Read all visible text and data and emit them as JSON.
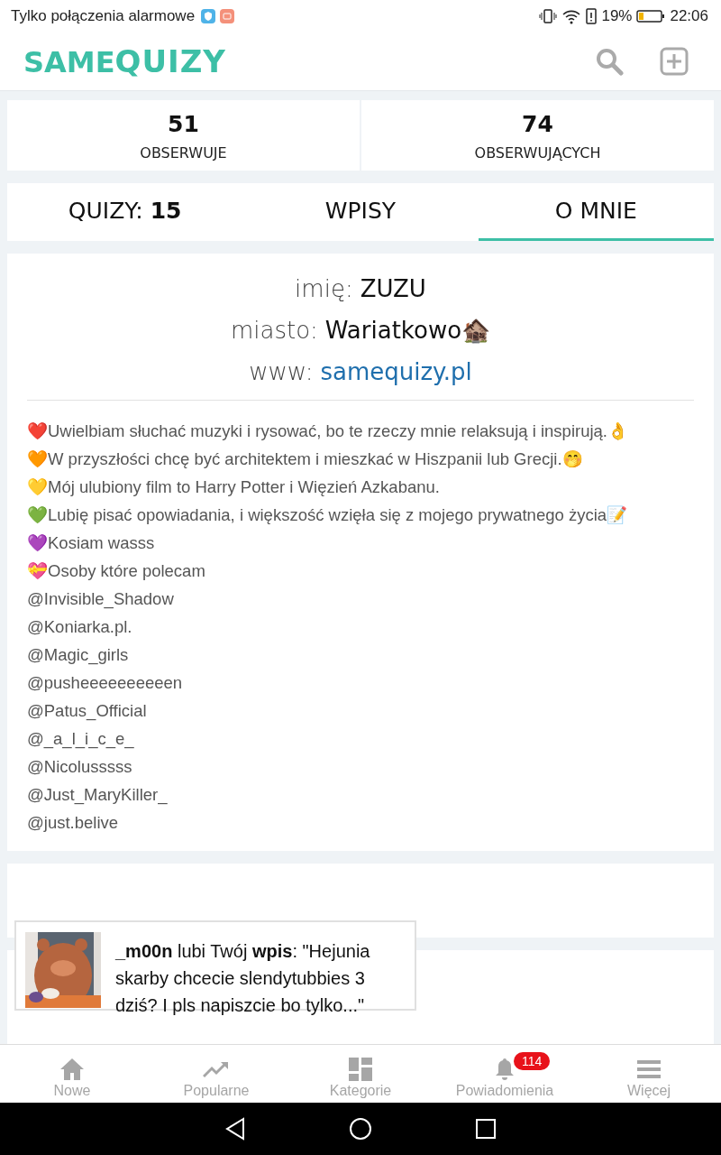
{
  "status_bar": {
    "carrier": "Tylko połączenia alarmowe",
    "battery_text": "19%",
    "time": "22:06"
  },
  "header": {
    "logo_prefix": "SAME",
    "logo_suffix": "QUIZY"
  },
  "stats": [
    {
      "value": "51",
      "label": "OBSERWUJE"
    },
    {
      "value": "74",
      "label": "OBSERWUJĄCYCH"
    }
  ],
  "tabs": [
    {
      "label": "QUIZY: **15**",
      "selected": false
    },
    {
      "label": "WPISY",
      "selected": false
    },
    {
      "label": "O MNIE",
      "selected": true
    }
  ],
  "about": {
    "fields": [
      {
        "label": "imię:",
        "value": "ZUZU",
        "kind": "text"
      },
      {
        "label": "miasto:",
        "value": "Wariatkowo🏚️",
        "kind": "text"
      },
      {
        "label": "www:",
        "value": "samequizy.pl",
        "kind": "link"
      }
    ],
    "lines": [
      "❤️Uwielbiam słuchać muzyki i rysować, bo te rzeczy mnie relaksują i inspirują.👌",
      "🧡W przyszłości chcę być architektem i mieszkać w Hiszpanii lub Grecji.🤭",
      "💛Mój ulubiony film to Harry Potter i Więzień Azkabanu.",
      "💚Lubię pisać opowiadania, i większość wzięła się z mojego prywatnego życia📝",
      "💜Kosiam wasss",
      "💝Osoby które polecam",
      "@Invisible_Shadow",
      "@Koniarka.pl.",
      "@Magic_girls",
      "@pusheeeeeeeeeen",
      "@Patus_Official",
      "@_a_l_i_c_e_",
      "@Nicolusssss",
      "@Just_MaryKiller_",
      "@just.belive"
    ]
  },
  "toast": {
    "text": "**_m00n** lubi Twój **wpis**: \"Hejunia skarby chcecie slendytubbies 3 dziś? I pls napiszcie bo tylko...\""
  },
  "bottom_nav": [
    {
      "label": "Nowe",
      "kind": "home"
    },
    {
      "label": "Popularne",
      "kind": "trend"
    },
    {
      "label": "Kategorie",
      "kind": "grid"
    },
    {
      "label": "Powiadomienia",
      "kind": "bell",
      "badge": "114"
    },
    {
      "label": "Więcej",
      "kind": "menu"
    }
  ]
}
